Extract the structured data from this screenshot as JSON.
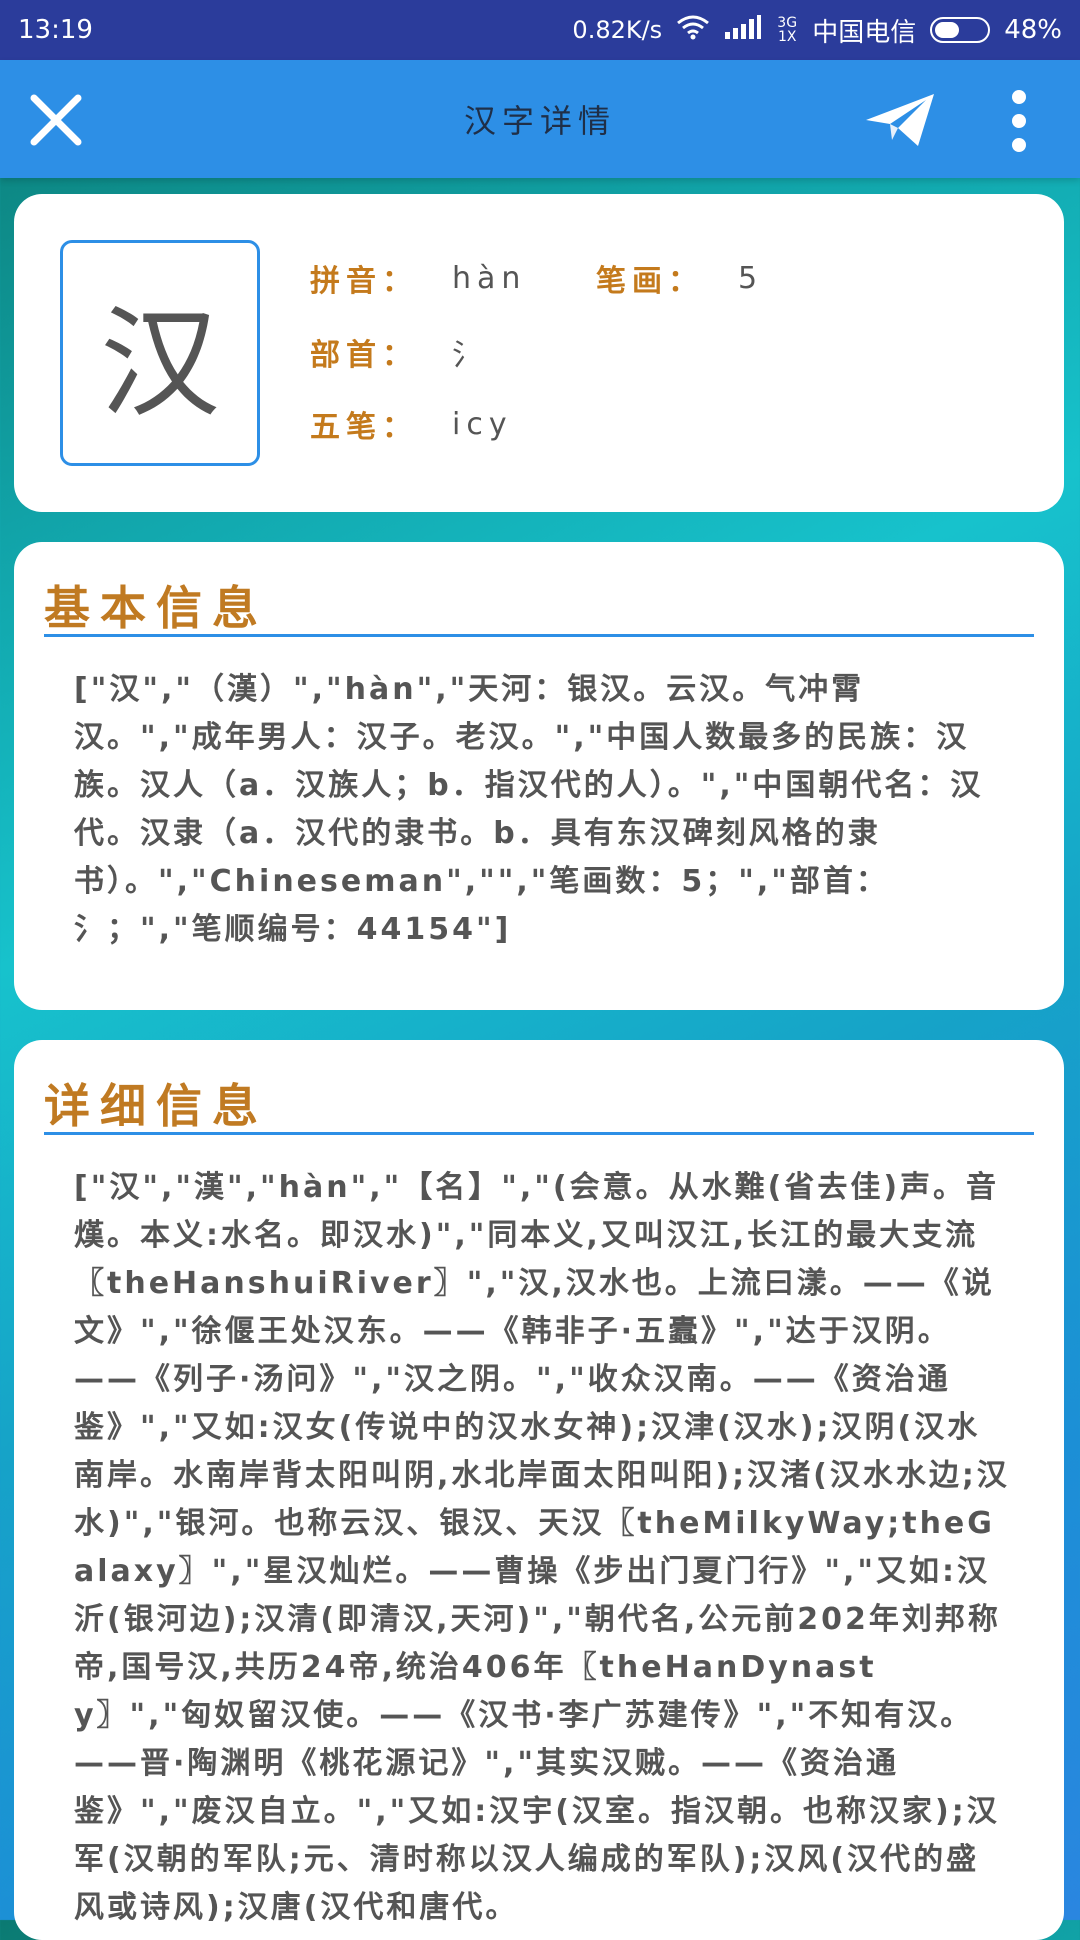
{
  "status_bar": {
    "time": "13:19",
    "net_speed": "0.82K/s",
    "network_type": "3G 1X",
    "carrier": "中国电信",
    "battery": "48%",
    "battery_level": 0.48
  },
  "app_bar": {
    "title": "汉字详情",
    "icons": [
      "close-icon",
      "send-icon",
      "more-vert-icon"
    ]
  },
  "char_card": {
    "character": "汉",
    "pinyin_label": "拼音：",
    "pinyin": "hàn",
    "strokes_label": "笔画：",
    "strokes": "5",
    "radical_label": "部首：",
    "radical": "氵",
    "wubi_label": "五笔：",
    "wubi": "icy"
  },
  "basic_info": {
    "title": "基本信息",
    "text": "[\"汉\",\"（漢）\",\"hàn\",\"天河：银汉。云汉。气冲霄汉。\",\"成年男人：汉子。老汉。\",\"中国人数最多的民族：汉族。汉人（a．汉族人；b．指汉代的人）。\",\"中国朝代名：汉代。汉隶（a．汉代的隶书。b．具有东汉碑刻风格的隶书）。\",\"Chineseman\",\"\",\"笔画数：5；\",\"部首：氵；\",\"笔顺编号：44154\"]"
  },
  "detail_info": {
    "title": "详细信息",
    "text": "[\"汉\",\"漢\",\"hàn\",\"【名】\",\"(会意。从水難(省去佳)声。音熯。本义:水名。即汉水)\",\"同本义,又叫汉江,长江的最大支流〖theHanshuiRiver〗\",\"汉,汉水也。上流曰漾。——《说文》\",\"徐偃王处汉东。——《韩非子·五蠹》\",\"达于汉阴。——《列子·汤问》\",\"汉之阴。\",\"收众汉南。——《资治通鉴》\",\"又如:汉女(传说中的汉水女神);汉津(汉水);汉阴(汉水南岸。水南岸背太阳叫阴,水北岸面太阳叫阳);汉渚(汉水水边;汉水)\",\"银河。也称云汉、银汉、天汉〖theMilkyWay;theGalaxy〗\",\"星汉灿烂。——曹操《步出门夏门行》\",\"又如:汉沂(银河边);汉清(即清汉,天河)\",\"朝代名,公元前202年刘邦称帝,国号汉,共历24帝,统治406年〖theHanDynasty〗\",\"匈奴留汉使。——《汉书·李广苏建传》\",\"不知有汉。——晋·陶渊明《桃花源记》\",\"其实汉贼。——《资治通鉴》\",\"废汉自立。\",\"又如:汉宇(汉室。指汉朝。也称汉家);汉军(汉朝的军队;元、清时称以汉人编成的军队);汉风(汉代的盛风或诗风);汉唐(汉代和唐代。"
  }
}
